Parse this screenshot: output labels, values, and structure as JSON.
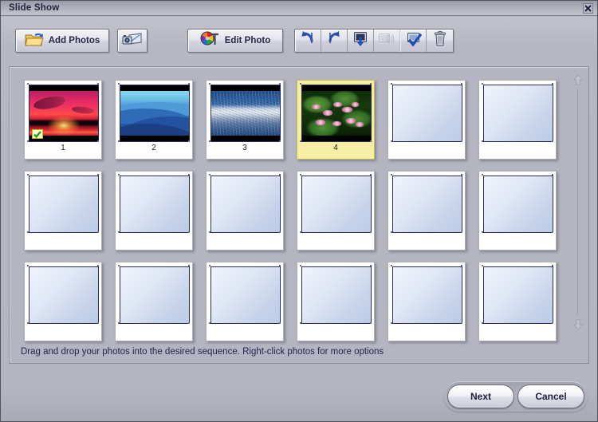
{
  "window": {
    "title": "Slide Show",
    "close_icon": "close-icon"
  },
  "toolbar": {
    "add_photos_label": "Add Photos",
    "add_photos_icon": "folder-add-icon",
    "scanner_label": "",
    "scanner_icon": "scanner-camera-icon",
    "edit_photo_label": "Edit Photo",
    "edit_photo_icon": "color-wheel-text-icon",
    "tools": [
      {
        "name": "rotate-left-icon",
        "title": "Rotate Left",
        "enabled": true
      },
      {
        "name": "rotate-right-icon",
        "title": "Rotate Right",
        "enabled": true
      },
      {
        "name": "save-to-screen-icon",
        "title": "Save",
        "enabled": true
      },
      {
        "name": "sound-icon",
        "title": "Sound",
        "enabled": false
      },
      {
        "name": "select-all-icon",
        "title": "Select All",
        "enabled": true
      },
      {
        "name": "trash-icon",
        "title": "Delete",
        "enabled": true
      }
    ]
  },
  "panel": {
    "hint": "Drag and drop your photos into the desired sequence. Right-click photos for more options",
    "scroll_up_icon": "scroll-up-arrow-icon",
    "scroll_down_icon": "scroll-down-arrow-icon",
    "slots": [
      {
        "caption": "1",
        "filled": true,
        "selected": false,
        "kind": "sunset",
        "badge": "checkmark-badge"
      },
      {
        "caption": "2",
        "filled": true,
        "selected": false,
        "kind": "mountains",
        "badge": ""
      },
      {
        "caption": "3",
        "filled": true,
        "selected": false,
        "kind": "water",
        "badge": ""
      },
      {
        "caption": "4",
        "filled": true,
        "selected": true,
        "kind": "lilies",
        "badge": ""
      },
      {
        "caption": "",
        "filled": false,
        "selected": false,
        "kind": "empty",
        "badge": ""
      },
      {
        "caption": "",
        "filled": false,
        "selected": false,
        "kind": "empty",
        "badge": ""
      },
      {
        "caption": "",
        "filled": false,
        "selected": false,
        "kind": "empty",
        "badge": ""
      },
      {
        "caption": "",
        "filled": false,
        "selected": false,
        "kind": "empty",
        "badge": ""
      },
      {
        "caption": "",
        "filled": false,
        "selected": false,
        "kind": "empty",
        "badge": ""
      },
      {
        "caption": "",
        "filled": false,
        "selected": false,
        "kind": "empty",
        "badge": ""
      },
      {
        "caption": "",
        "filled": false,
        "selected": false,
        "kind": "empty",
        "badge": ""
      },
      {
        "caption": "",
        "filled": false,
        "selected": false,
        "kind": "empty",
        "badge": ""
      },
      {
        "caption": "",
        "filled": false,
        "selected": false,
        "kind": "empty",
        "badge": ""
      },
      {
        "caption": "",
        "filled": false,
        "selected": false,
        "kind": "empty",
        "badge": ""
      },
      {
        "caption": "",
        "filled": false,
        "selected": false,
        "kind": "empty",
        "badge": ""
      },
      {
        "caption": "",
        "filled": false,
        "selected": false,
        "kind": "empty",
        "badge": ""
      },
      {
        "caption": "",
        "filled": false,
        "selected": false,
        "kind": "empty",
        "badge": ""
      },
      {
        "caption": "",
        "filled": false,
        "selected": false,
        "kind": "empty",
        "badge": ""
      }
    ]
  },
  "footer": {
    "next_label": "Next",
    "cancel_label": "Cancel"
  },
  "colors": {
    "dialog_bg": "#b4b5c0",
    "title_text": "#22223c",
    "hint_text": "#232350",
    "selected_frame": "#f5eea4",
    "icon_blue": "#2b50a8"
  }
}
